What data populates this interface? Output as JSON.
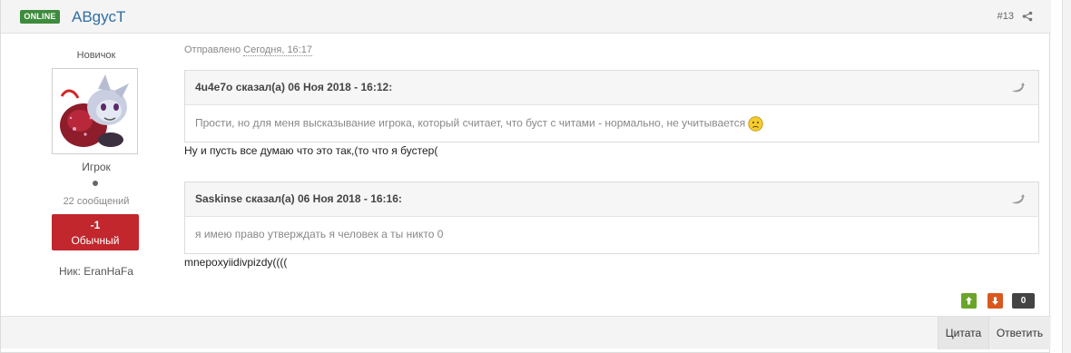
{
  "header": {
    "online_badge": "ONLINE",
    "author": "АBgусТ",
    "post_number": "#13"
  },
  "user": {
    "rank": "Новичок",
    "group": "Игрок",
    "post_count": "22 сообщений",
    "reputation_value": "-1",
    "reputation_label": "Обычный",
    "nick": "Ник: EranHaFa"
  },
  "post": {
    "sent_label": "Отправлено",
    "sent_date": "Сегодня, 16:17",
    "quotes": [
      {
        "author_line": "4u4e7o сказал(а) 06 Ноя 2018 - 16:12:",
        "text": "Прости, но для меня высказывание игрока, который считает, что буст с читами - нормально, не учитывается"
      },
      {
        "author_line": "Saskinse сказал(а) 06 Ноя 2018 - 16:16:",
        "text": "я имею право утверждать я человек а ты никто 0"
      }
    ],
    "reply_1": "Ну и пусть все думаю что это так,(то что я бустер(",
    "reply_2": "mnepoxyiidivpizdy(((("
  },
  "votes": {
    "count": "0"
  },
  "footer": {
    "quote_button": "Цитата",
    "reply_button": "Ответить"
  },
  "colors": {
    "online": "#3d8b3d",
    "author": "#2f6ea4",
    "reputation_negative": "#c1272d",
    "vote_up": "#6aa52a",
    "vote_down": "#d9581e"
  },
  "icons": [
    "share-icon",
    "quote-icon",
    "sad-smiley-icon",
    "arrow-up-icon",
    "arrow-down-icon"
  ]
}
